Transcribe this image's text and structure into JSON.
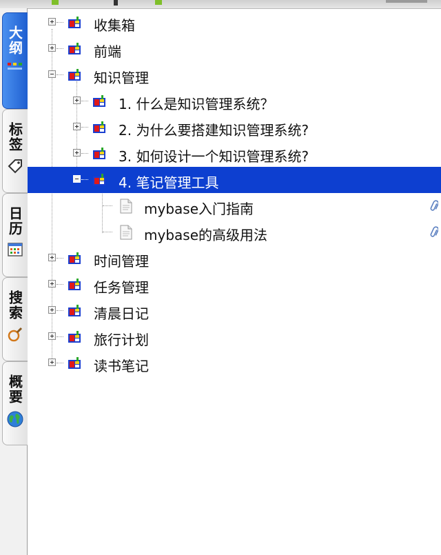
{
  "sidebar": {
    "tabs": [
      {
        "label": "大纲",
        "icon": "outline-icon",
        "active": true
      },
      {
        "label": "标签",
        "icon": "tag-icon",
        "active": false
      },
      {
        "label": "日历",
        "icon": "calendar-icon",
        "active": false
      },
      {
        "label": "搜索",
        "icon": "search-icon",
        "active": false
      },
      {
        "label": "概要",
        "icon": "globe-icon",
        "active": false
      }
    ]
  },
  "tree": {
    "items": [
      {
        "label": "收集箱",
        "level": 0,
        "state": "collapsed"
      },
      {
        "label": "前端",
        "level": 0,
        "state": "collapsed"
      },
      {
        "label": "知识管理",
        "level": 0,
        "state": "expanded"
      },
      {
        "label": "1. 什么是知识管理系统？",
        "level": 1,
        "state": "collapsed"
      },
      {
        "label": "2. 为什么要搭建知识管理系统?",
        "level": 1,
        "state": "collapsed"
      },
      {
        "label": "3. 如何设计一个知识管理系统?",
        "level": 1,
        "state": "collapsed"
      },
      {
        "label": "4. 笔记管理工具",
        "level": 1,
        "state": "expanded",
        "selected": true
      },
      {
        "label": "mybase入门指南",
        "level": 2,
        "type": "document",
        "attachment": true
      },
      {
        "label": "mybase的高级用法",
        "level": 2,
        "type": "document",
        "attachment": true
      },
      {
        "label": "时间管理",
        "level": 0,
        "state": "collapsed"
      },
      {
        "label": "任务管理",
        "level": 0,
        "state": "collapsed"
      },
      {
        "label": "清晨日记",
        "level": 0,
        "state": "collapsed"
      },
      {
        "label": "旅行计划",
        "level": 0,
        "state": "collapsed"
      },
      {
        "label": "读书笔记",
        "level": 0,
        "state": "collapsed"
      }
    ]
  },
  "colors": {
    "selection": "#0d3fd0",
    "active_tab": "#2f6fe0",
    "folder_red": "#e01919",
    "folder_yellow": "#f7d21a",
    "folder_blue": "#1a3fd0",
    "folder_green": "#2aa82a"
  }
}
